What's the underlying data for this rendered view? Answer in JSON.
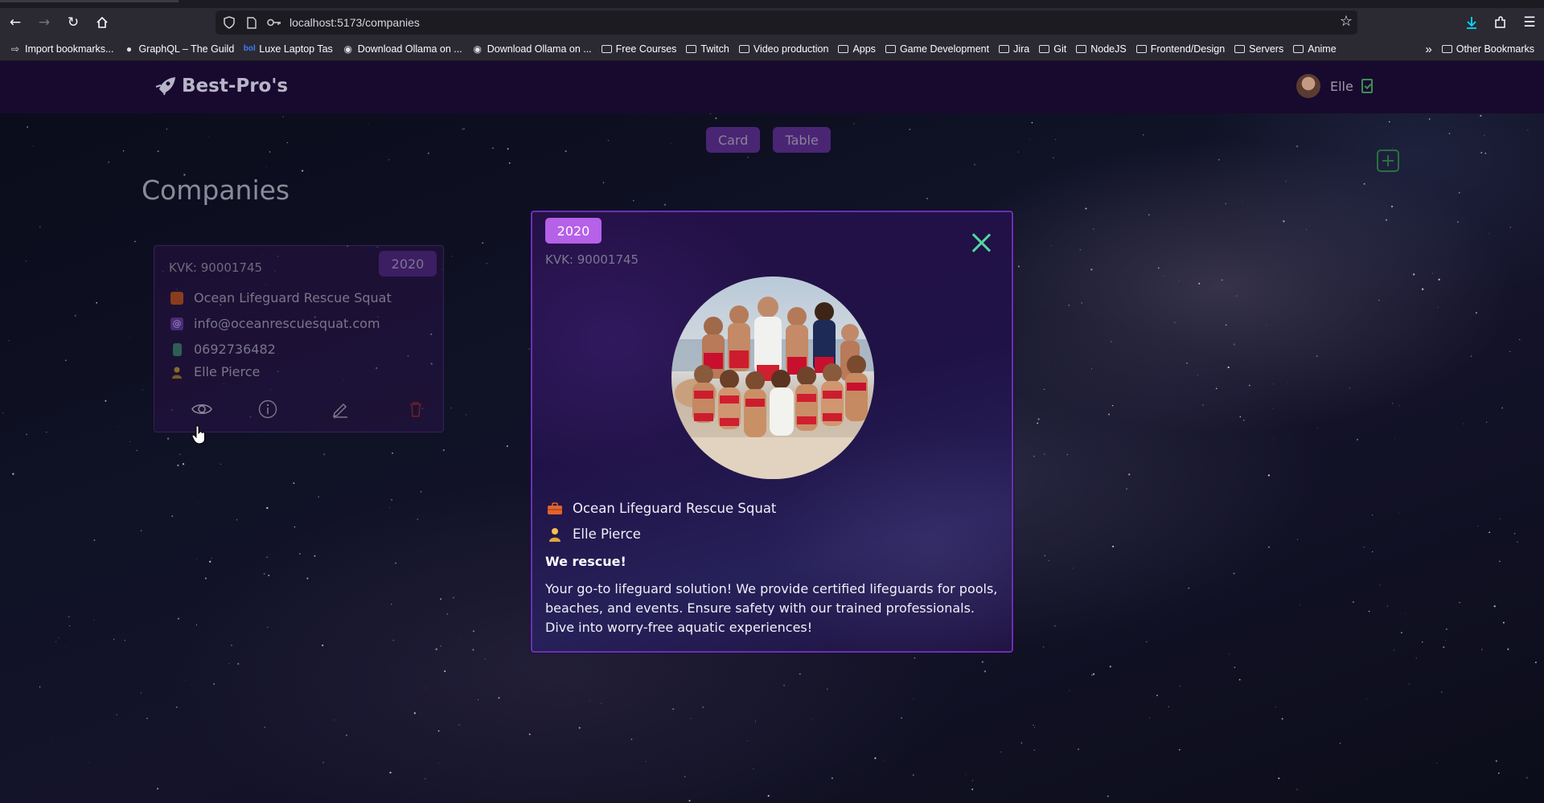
{
  "browser": {
    "url": "localhost:5173/companies",
    "bookmarks": [
      {
        "label": "Import bookmarks...",
        "icon": "import-icon"
      },
      {
        "label": "GraphQL – The Guild",
        "icon": "guild-icon"
      },
      {
        "label": "Luxe Laptop Tas",
        "icon": "bol-icon"
      },
      {
        "label": "Download Ollama on ...",
        "icon": "ollama-icon"
      },
      {
        "label": "Download Ollama on ...",
        "icon": "ollama-icon"
      },
      {
        "label": "Free Courses",
        "icon": "folder-icon"
      },
      {
        "label": "Twitch",
        "icon": "folder-icon"
      },
      {
        "label": "Video production",
        "icon": "folder-icon"
      },
      {
        "label": "Apps",
        "icon": "folder-icon"
      },
      {
        "label": "Game Development",
        "icon": "folder-icon"
      },
      {
        "label": "Jira",
        "icon": "folder-icon"
      },
      {
        "label": "Git",
        "icon": "folder-icon"
      },
      {
        "label": "NodeJS",
        "icon": "folder-icon"
      },
      {
        "label": "Frontend/Design",
        "icon": "folder-icon"
      },
      {
        "label": "Servers",
        "icon": "folder-icon"
      },
      {
        "label": "Anime",
        "icon": "folder-icon"
      }
    ],
    "other_bookmarks": "Other Bookmarks"
  },
  "header": {
    "brand": "Best-Pro's",
    "user_name": "Elle"
  },
  "view_toggle": {
    "card_label": "Card",
    "table_label": "Table"
  },
  "page": {
    "title": "Companies"
  },
  "card": {
    "year": "2020",
    "kvk": "KVK: 90001745",
    "company_name": "Ocean Lifeguard Rescue Squat",
    "email": "info@oceanrescuesquat.com",
    "phone": "0692736482",
    "contact": "Elle Pierce"
  },
  "modal": {
    "year": "2020",
    "kvk": "KVK: 90001745",
    "company_name": "Ocean Lifeguard Rescue Squat",
    "contact": "Elle Pierce",
    "tagline": "We rescue!",
    "description": "Your go-to lifeguard solution! We provide certified lifeguards for pools, beaches, and events. Ensure safety with our trained professionals. Dive into worry-free aquatic experiences!"
  },
  "colors": {
    "header_bg": "#170a2e",
    "accent_purple": "#b561e8",
    "modal_border": "#6b2fb4",
    "close_green": "#54d6a0",
    "add_green": "#2d6e42"
  }
}
